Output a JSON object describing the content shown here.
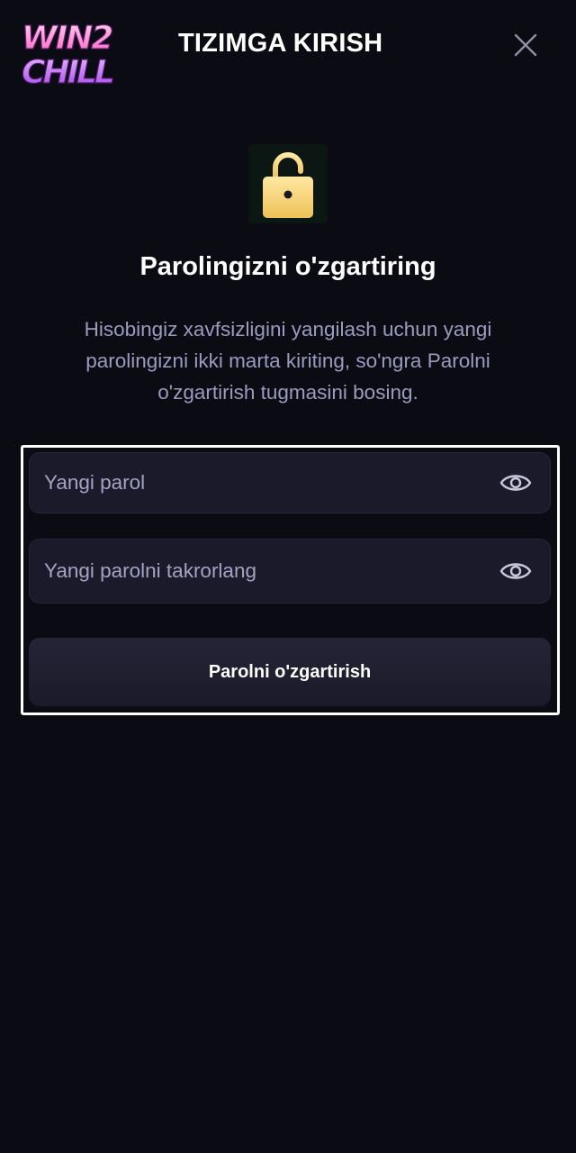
{
  "header": {
    "logo_text_line1": "WIN2",
    "logo_text_line2": "CHILL",
    "title": "TIZIMGA KIRISH",
    "close_icon": "close-icon"
  },
  "lock_icon": "unlocked-padlock-icon",
  "main": {
    "heading": "Parolingizni o'zgartiring",
    "description": "Hisobingiz xavfsizligini yangilash uchun yangi parolingizni ikki marta kiriting, so'ngra Parolni o'zgartirish tugmasini bosing."
  },
  "form": {
    "new_password": {
      "value": "",
      "placeholder": "Yangi parol",
      "icon": "eye-icon"
    },
    "repeat_password": {
      "value": "",
      "placeholder": "Yangi parolni takrorlang",
      "icon": "eye-icon"
    },
    "submit_label": "Parolni o'zgartirish"
  },
  "colors": {
    "background": "#0b0b13",
    "field_bg": "#1b1a2b",
    "lock_gold": "#f4d170",
    "logo_pink": "#ff6fc8",
    "logo_purple": "#b44cf0"
  }
}
